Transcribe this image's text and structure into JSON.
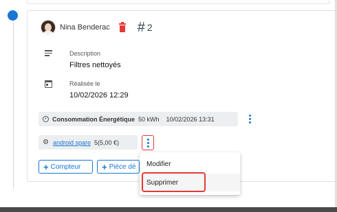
{
  "author": {
    "name": "Nina Benderac",
    "hash": "#",
    "number": "2"
  },
  "description": {
    "label": "Description",
    "value": "Filtres nettoyés"
  },
  "realisee": {
    "label": "Réalisée le",
    "value": "10/02/2026 12:29"
  },
  "consumption_chip": {
    "icon": "gauge-icon",
    "title": "Consommation Énergétique",
    "amount": "50 kWh",
    "date": "10/02/2026 13:31"
  },
  "spare_chip": {
    "icon": "gear-icon",
    "name": "android spare",
    "qty": "5(5,00 €)"
  },
  "buttons": {
    "compteur": "Compteur",
    "piece": "Pièce dé"
  },
  "menu": {
    "modifier": "Modifier",
    "supprimer": "Supprimer"
  },
  "colors": {
    "primary": "#1976d2",
    "danger": "#e53935"
  }
}
